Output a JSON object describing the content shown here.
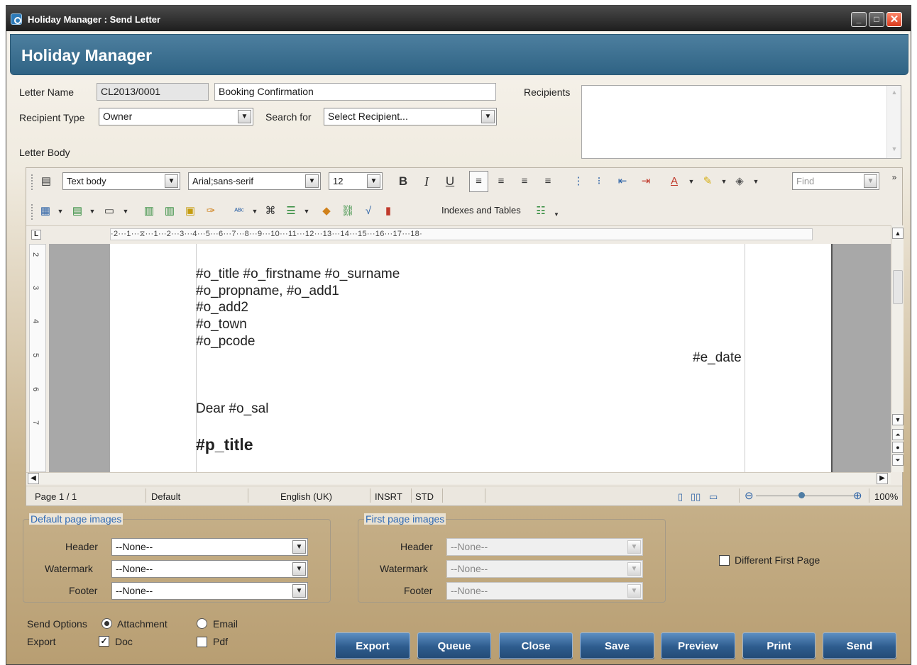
{
  "window": {
    "title": "Holiday Manager : Send Letter",
    "min": "_",
    "max": "□",
    "close": "✕"
  },
  "banner": {
    "title": "Holiday Manager"
  },
  "form": {
    "letter_name_label": "Letter Name",
    "letter_code": "CL2013/0001",
    "letter_title": "Booking Confirmation",
    "recipients_label": "Recipients",
    "recipient_type_label": "Recipient Type",
    "recipient_type_value": "Owner",
    "search_for_label": "Search for",
    "search_for_value": "Select Recipient...",
    "letter_body_label": "Letter Body"
  },
  "toolbar": {
    "paragraph_style": "Text body",
    "font_name": "Arial;sans-serif",
    "font_size": "12",
    "bold": "B",
    "italic": "I",
    "underline": "U",
    "find_placeholder": "Find",
    "indexes_tables": "Indexes and Tables"
  },
  "ruler": {
    "h": "·2···1···⧖···1···2···3···4···5···6···7···8···9···10···11···12···13···14···15···16···17···18·",
    "v": [
      "2",
      "3",
      "4",
      "5",
      "6",
      "7"
    ]
  },
  "document": {
    "lines": [
      "#o_title #o_firstname #o_surname",
      "#o_propname, #o_add1",
      "#o_add2",
      "#o_town",
      "#o_pcode"
    ],
    "date": "#e_date",
    "salutation": "Dear #o_sal",
    "heading": "#p_title"
  },
  "statusbar": {
    "page": "Page 1 / 1",
    "style": "Default",
    "language": "English (UK)",
    "insert": "INSRT",
    "std": "STD",
    "zoom": "100%"
  },
  "default_images": {
    "legend": "Default page images",
    "header_label": "Header",
    "header_value": "--None--",
    "watermark_label": "Watermark",
    "watermark_value": "--None--",
    "footer_label": "Footer",
    "footer_value": "--None--"
  },
  "first_images": {
    "legend": "First page images",
    "header_label": "Header",
    "header_value": "--None--",
    "watermark_label": "Watermark",
    "watermark_value": "--None--",
    "footer_label": "Footer",
    "footer_value": "--None--"
  },
  "different_first_page": "Different First Page",
  "send_options": {
    "label": "Send Options",
    "attachment": "Attachment",
    "email": "Email",
    "export_label": "Export",
    "doc": "Doc",
    "pdf": "Pdf"
  },
  "buttons": [
    "Export",
    "Queue",
    "Close",
    "Save",
    "Preview",
    "Print",
    "Send"
  ]
}
